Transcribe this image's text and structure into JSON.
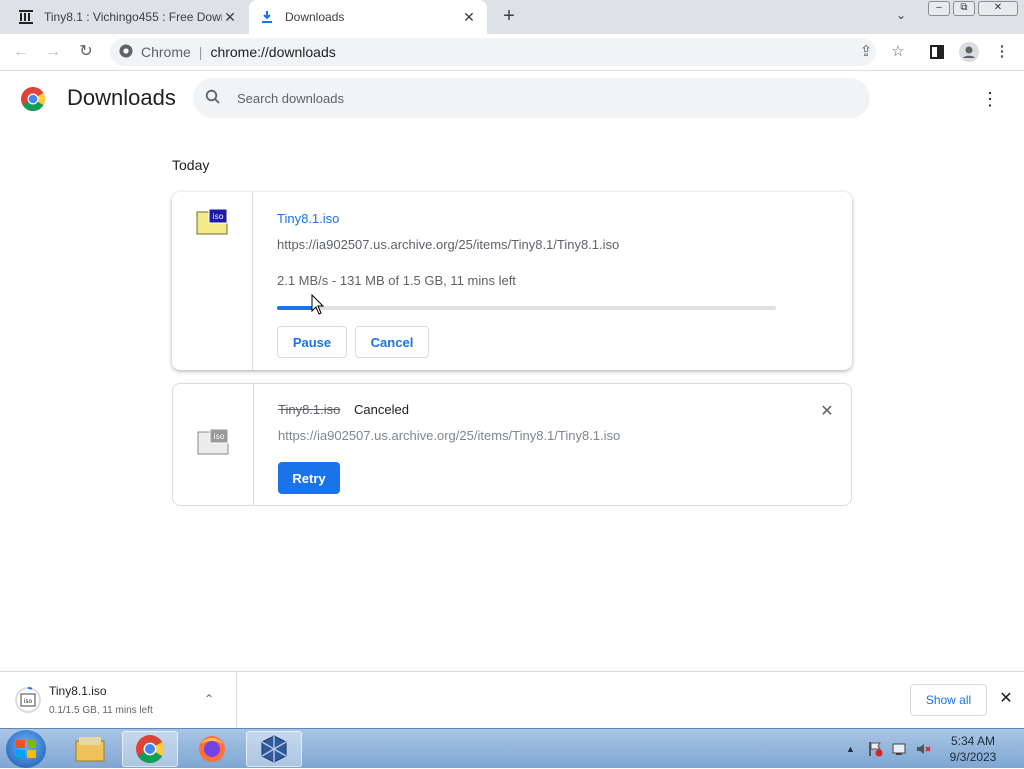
{
  "tabs": [
    {
      "label": "Tiny8.1 : Vichingo455 : Free Down",
      "icon": "archive-icon"
    },
    {
      "label": "Downloads",
      "icon": "download-icon"
    }
  ],
  "toolbar": {
    "omnibox_label": "Chrome",
    "omnibox_url": "chrome://downloads"
  },
  "header": {
    "title": "Downloads",
    "search_placeholder": "Search downloads"
  },
  "date_header": "Today",
  "downloads": [
    {
      "filename": "Tiny8.1.iso",
      "url": "https://ia902507.us.archive.org/25/items/Tiny8.1/Tiny8.1.iso",
      "status": "2.1 MB/s - 131 MB of 1.5 GB, 11 mins left",
      "progress_percent": 7,
      "pause_label": "Pause",
      "cancel_label": "Cancel",
      "icon_text": "iso",
      "accent": "#1a73e8"
    },
    {
      "filename": "Tiny8.1.iso",
      "state": "Canceled",
      "url": "https://ia902507.us.archive.org/25/items/Tiny8.1/Tiny8.1.iso",
      "retry_label": "Retry",
      "icon_text": "iso"
    }
  ],
  "shelf": {
    "filename": "Tiny8.1.iso",
    "status": "0.1/1.5 GB, 11 mins left",
    "show_all_label": "Show all"
  },
  "taskbar": {
    "time": "5:34 AM",
    "date": "9/3/2023",
    "apps": [
      "windows-explorer",
      "chrome",
      "firefox",
      "virtualbox"
    ]
  }
}
